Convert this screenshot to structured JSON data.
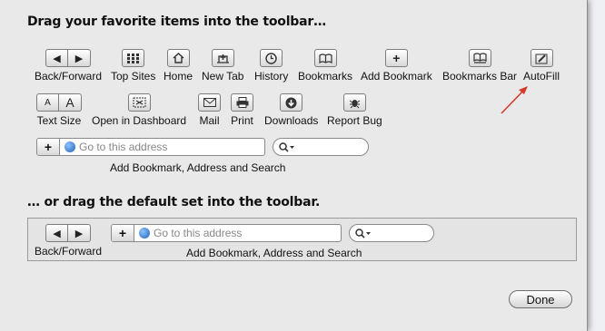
{
  "sheet": {
    "heading_top": "Drag your favorite items into the toolbar…",
    "heading_bottom": "… or drag the default set into the toolbar."
  },
  "tools_row1": [
    {
      "name": "back-forward",
      "label": "Back/Forward",
      "icon": "back-forward-icon"
    },
    {
      "name": "top-sites",
      "label": "Top Sites",
      "icon": "grid-icon"
    },
    {
      "name": "home",
      "label": "Home",
      "icon": "house-icon"
    },
    {
      "name": "new-tab",
      "label": "New Tab",
      "icon": "new-tab-icon"
    },
    {
      "name": "history",
      "label": "History",
      "icon": "clock-icon"
    },
    {
      "name": "bookmarks",
      "label": "Bookmarks",
      "icon": "book-icon"
    },
    {
      "name": "add-bookmark",
      "label": "Add Bookmark",
      "icon": "plus-icon"
    },
    {
      "name": "bookmarks-bar",
      "label": "Bookmarks Bar",
      "icon": "book-icon"
    },
    {
      "name": "autofill",
      "label": "AutoFill",
      "icon": "pencil-icon"
    }
  ],
  "tools_row2": [
    {
      "name": "text-size",
      "label": "Text Size",
      "icon": "text-size-icon"
    },
    {
      "name": "open-in-dashboard",
      "label": "Open in Dashboard",
      "icon": "scissors-icon"
    },
    {
      "name": "mail",
      "label": "Mail",
      "icon": "envelope-icon"
    },
    {
      "name": "print",
      "label": "Print",
      "icon": "printer-icon"
    },
    {
      "name": "downloads",
      "label": "Downloads",
      "icon": "download-icon"
    },
    {
      "name": "report-bug",
      "label": "Report Bug",
      "icon": "bug-icon"
    }
  ],
  "combo": {
    "address_placeholder": "Go to this address",
    "label": "Add Bookmark, Address and Search"
  },
  "default_set": {
    "back_forward_label": "Back/Forward",
    "address_placeholder": "Go to this address",
    "combo_label": "Add Bookmark, Address and Search"
  },
  "done_label": "Done",
  "colors": {
    "arrow": "#d33a2c",
    "sheet": "#e8e8e8"
  }
}
